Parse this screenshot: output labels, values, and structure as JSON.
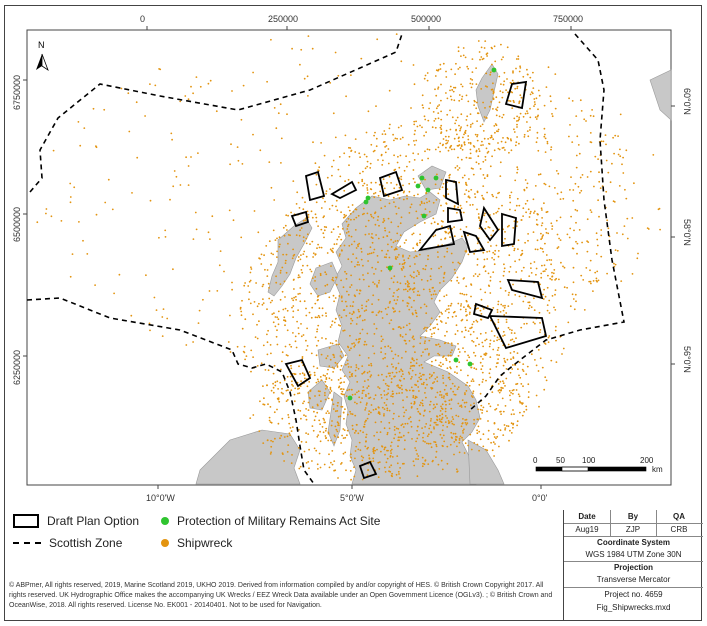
{
  "map": {
    "colors": {
      "sea": "#ffffff",
      "land": "#c8c8c8",
      "land_edge": "#9a9a9a",
      "shipwreck": "#e39410",
      "military": "#2fc42f",
      "plan_option": "#000000"
    },
    "icon": "north-arrow-icon",
    "north_label": "N",
    "grid_top": [
      "0",
      "250000",
      "500000",
      "750000"
    ],
    "grid_left": [
      "6750000",
      "6500000",
      "6250000"
    ],
    "graticule_bottom": [
      "10°0'W",
      "5°0'W",
      "0°0'"
    ],
    "graticule_right": [
      "60°0'N",
      "58°0'N",
      "56°0'N"
    ],
    "scale": {
      "ticks": [
        "0",
        "50",
        "100",
        "200"
      ],
      "unit": "km"
    }
  },
  "legend": {
    "draft_plan_option": "Draft Plan Option",
    "scottish_zone": "Scottish Zone",
    "military_remains": "Protection of Military Remains Act Site",
    "shipwreck": "Shipwreck"
  },
  "credits": "© ABPmer, All rights reserved, 2019, Marine Scotland 2019, UKHO 2019. Derived from information compiled by and/or copyright of HES. © British Crown Copyright 2017. All rights reserved. UK Hydrographic Office makes the accompanying UK Wrecks / EEZ Wreck Data available under an Open Government Licence (OGLv3). ; © British Crown and OceanWise, 2018. All rights reserved. License No. EK001 - 20140401. Not to be used for Navigation.",
  "info": {
    "date_label": "Date",
    "by_label": "By",
    "qa_label": "QA",
    "date_value": "Aug19",
    "by_value": "ZJP",
    "qa_value": "CRB",
    "coord_label": "Coordinate System",
    "coord_value": "WGS 1984 UTM Zone 30N",
    "proj_label": "Projection",
    "proj_value": "Transverse Mercator",
    "project_no": "Project no. 4659",
    "filename": "Fig_Shipwrecks.mxd"
  }
}
